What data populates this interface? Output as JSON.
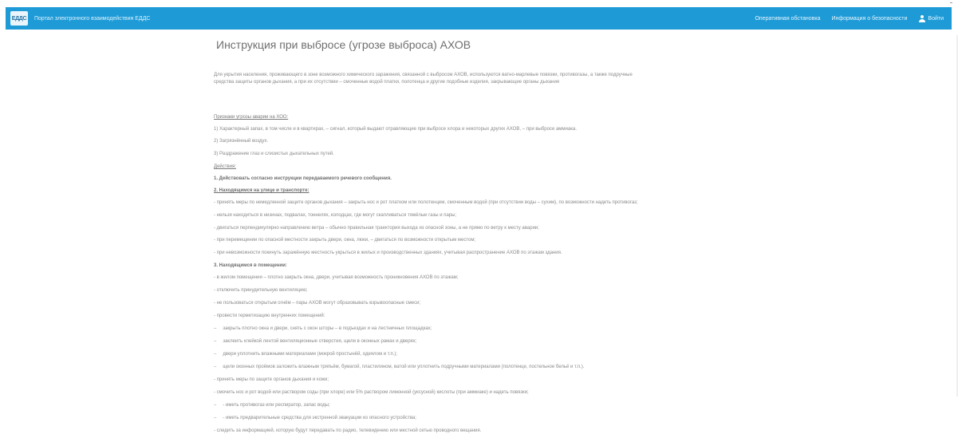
{
  "header": {
    "logo_text": "ЕДДС",
    "site_title": "Портал электронного взаимодействия ЕДДС",
    "nav": [
      {
        "label": "Оперативная обстановка"
      },
      {
        "label": "Информация о безопасности"
      },
      {
        "label": "Войти"
      }
    ]
  },
  "article": {
    "title": "Инструкция при выбросе (угрозе выброса) АХОВ",
    "lines": [
      "Для укрытия населения, проживающего в зоне возможного химического заражения, связанной с выбросом АХОВ, используются ватно-марлевые повязки, противогазы, а также подручные",
      "средства защиты органов дыхания, а при их отсутствии – смоченные водой платки, полотенца и другие подобные изделия, закрывающие органы дыхания",
      "Признаки угрозы аварии на ХОО:",
      "1) Характерный запах, в том числе и в квартирах, – сигнал, который выдают отравляющие при выбросе хлора и некоторых других АХОВ, – при выбросе аммиака.",
      "2) Загрязнённый воздух.",
      "3) Раздражение глаз и слизистых дыхательных путей.",
      "Действия:",
      "1. Действовать согласно инструкции передаваемого речевого сообщения.",
      "2. Находящимся на улице и транспорте:",
      "- принять меры по немедленной защите органов дыхания – закрыть нос и рот платком или полотенцем, смоченным водой (при отсутствии воды – сухим), по возможности надеть противогаз;",
      "- нельзя находиться в низинах, подвалах, тоннелях, колодцах, где могут скапливаться тяжёлые газы и пары;",
      "- двигаться перпендикулярно направлению ветра – обычно правильная траектория выхода из опасной зоны, а не прямо по ветру к месту аварии;",
      "- при перемещении по опасной местности закрыть двери, окна, люки, – двигаться по возможности открытым местом;",
      "- при невозможности покинуть заражённую местность укрыться в жилых и производственных зданиях, учитывая распространение АХОВ по этажам здания.",
      "3. Находящимся в помещении:",
      "- в жилом помещении – плотно закрыть окна, двери, учитывая возможность проникновения АХОВ по этажам;",
      "- отключить принудительную вентиляцию;",
      "- не пользоваться открытым огнём – пары АХОВ могут образовывать взрывоопасные смеси;",
      "- провести герметизацию внутренних помещений:",
      "закрыть плотно окна и двери, снять с окон шторы – в подъездах и на лестничных площадках;",
      "заклеить клейкой лентой вентиляционные отверстия, щели в оконных рамах и дверях;",
      "двери уплотнить влажными материалами (мокрой простынёй, одеялом и т.п.);",
      "щели оконных проёмов заложить влажным тряпьём, бумагой, пластилином, ватой или уплотнить подручными материалами (полотенце, постельное бельё и т.п.).",
      "- принять меры по защите органов дыхания и кожи;",
      "- смочить нос и рот водой или раствором соды (при хлоре) или 5% раствором лимонной (уксусной) кислоты (при аммиаке) и надеть повязки;",
      "- иметь противогаз или респиратор, запас воды;",
      "- иметь предварительные средства для экстренной эвакуации из опасного устройства;",
      "- следить за информацией, которую будут передавать по радио, телевидению или местной сетью проводного вещания."
    ]
  }
}
